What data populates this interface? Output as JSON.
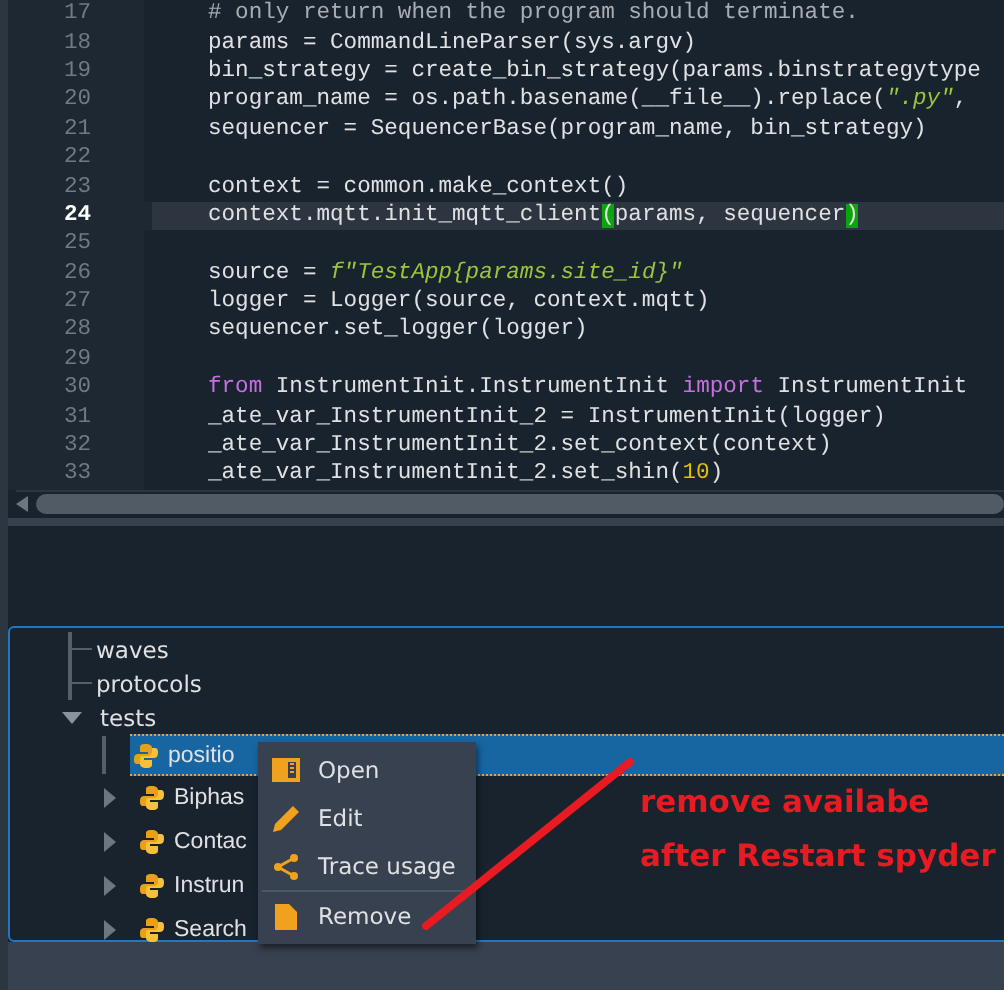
{
  "editor": {
    "lines": [
      {
        "number": "17",
        "current": false,
        "segments": [
          {
            "t": "# only return when the program should terminate.",
            "kind": "comment"
          }
        ]
      },
      {
        "number": "18",
        "current": false,
        "segments": [
          {
            "t": "params = CommandLineParser(sys.argv)",
            "kind": "plain"
          }
        ]
      },
      {
        "number": "19",
        "current": false,
        "segments": [
          {
            "t": "bin_strategy = create_bin_strategy(params.binstrategytype",
            "kind": "plain"
          }
        ]
      },
      {
        "number": "20",
        "current": false,
        "segments": [
          {
            "t": "program_name = os.path.basename(__file__).replace(",
            "kind": "plain"
          },
          {
            "t": "\".py\"",
            "kind": "str"
          },
          {
            "t": ",",
            "kind": "plain"
          }
        ]
      },
      {
        "number": "21",
        "current": false,
        "segments": [
          {
            "t": "sequencer = SequencerBase(program_name, bin_strategy)",
            "kind": "plain"
          }
        ]
      },
      {
        "number": "22",
        "current": false
      },
      {
        "number": "23",
        "current": false,
        "segments": [
          {
            "t": "context = common.make_context()",
            "kind": "plain"
          }
        ]
      },
      {
        "number": "24",
        "current": true,
        "segments": [
          {
            "t": "context.mqtt.init_mqtt_client",
            "kind": "plain"
          },
          {
            "t": "(",
            "kind": "match"
          },
          {
            "t": "params, sequencer",
            "kind": "plain"
          },
          {
            "t": ")",
            "kind": "match"
          }
        ]
      },
      {
        "number": "25",
        "current": false
      },
      {
        "number": "26",
        "current": false,
        "segments": [
          {
            "t": "source = ",
            "kind": "plain"
          },
          {
            "t": "f\"TestApp{params.site_id}\"",
            "kind": "str"
          }
        ]
      },
      {
        "number": "27",
        "current": false,
        "segments": [
          {
            "t": "logger = Logger(source, context.mqtt)",
            "kind": "plain"
          }
        ]
      },
      {
        "number": "28",
        "current": false,
        "segments": [
          {
            "t": "sequencer.set_logger(logger)",
            "kind": "plain"
          }
        ]
      },
      {
        "number": "29",
        "current": false
      },
      {
        "number": "30",
        "current": false,
        "segments": [
          {
            "t": "from",
            "kind": "kw"
          },
          {
            "t": " InstrumentInit.InstrumentInit ",
            "kind": "plain"
          },
          {
            "t": "import",
            "kind": "kw"
          },
          {
            "t": " InstrumentInit",
            "kind": "plain"
          }
        ]
      },
      {
        "number": "31",
        "current": false,
        "segments": [
          {
            "t": "_ate_var_InstrumentInit_2 = InstrumentInit(logger)",
            "kind": "plain"
          }
        ]
      },
      {
        "number": "32",
        "current": false,
        "segments": [
          {
            "t": "_ate_var_InstrumentInit_2.set_context(context)",
            "kind": "plain"
          }
        ]
      },
      {
        "number": "33",
        "current": false,
        "segments": [
          {
            "t": "_ate_var_InstrumentInit_2.set_shin(",
            "kind": "plain"
          },
          {
            "t": "10",
            "kind": "num"
          },
          {
            "t": ")",
            "kind": "plain"
          }
        ]
      }
    ]
  },
  "tree": {
    "items": [
      {
        "label": "waves",
        "kind": "leaf"
      },
      {
        "label": "protocols",
        "kind": "leaf"
      },
      {
        "label": "tests",
        "kind": "folder",
        "expanded": true,
        "children": [
          {
            "label": "positio",
            "kind": "file",
            "selected": true
          },
          {
            "label": "Biphas",
            "kind": "module",
            "expanded": false,
            "selected": false
          },
          {
            "label": "Contac",
            "kind": "module",
            "expanded": false,
            "selected": false
          },
          {
            "label": "Instrun",
            "kind": "module",
            "expanded": false,
            "selected": false
          },
          {
            "label": "Search",
            "kind": "module",
            "expanded": false,
            "selected": false
          }
        ]
      }
    ]
  },
  "context_menu": {
    "items": [
      {
        "label": "Open",
        "kind": "open"
      },
      {
        "label": "Edit",
        "kind": "edit"
      },
      {
        "label": "Trace usage",
        "kind": "trace"
      },
      {
        "label": "Remove",
        "kind": "remove",
        "separator_before": true
      }
    ]
  },
  "annotation": {
    "lines": [
      "remove availabe",
      "after Restart spyder"
    ]
  }
}
